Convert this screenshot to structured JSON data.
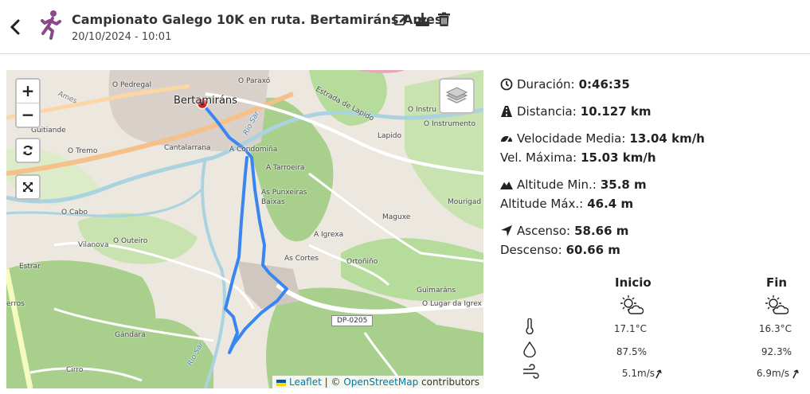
{
  "header": {
    "title": "Campionato Galego 10K en ruta. Bertamiráns Ames",
    "datetime": "20/10/2024 - 10:01"
  },
  "map": {
    "labels": [
      "O Pedregal",
      "O Paraxó",
      "Bertamiráns",
      "Estrada de Lapido",
      "O Instru",
      "O Instrumento",
      "Lapido",
      "Guitiande",
      "Ames",
      "Rio Sar",
      "O Tremo",
      "Cantalarrana",
      "A Condomiña",
      "A Tarroeira",
      "As Punxeiras Baixas",
      "Mourigad",
      "O Cabo",
      "Maguxe",
      "O Outeiro",
      "A Igrexa",
      "Vilanova",
      "As Cortes",
      "Ortoñiño",
      "Estrar",
      "Guimaráns",
      "O Lugar da Igrex",
      "erros",
      "Gándara",
      "Rio Sar",
      "Cirro"
    ],
    "road_ref": "DP-0205",
    "zoom_in": "+",
    "zoom_out": "−",
    "attribution": {
      "leaflet": "Leaflet",
      "sep": "| ©",
      "osm": "OpenStreetMap",
      "contributors": "contributors"
    }
  },
  "stats": {
    "duration_label": "Duración:",
    "duration_value": "0:46:35",
    "distance_label": "Distancia:",
    "distance_value": "10.127 km",
    "avg_speed_label": "Velocidade Media:",
    "avg_speed_value": "13.04 km/h",
    "max_speed_label": "Vel. Máxima:",
    "max_speed_value": "15.03 km/h",
    "min_alt_label": "Altitude Min.:",
    "min_alt_value": "35.8 m",
    "max_alt_label": "Altitude Máx.:",
    "max_alt_value": "46.4 m",
    "ascent_label": "Ascenso:",
    "ascent_value": "58.66 m",
    "descent_label": "Descenso:",
    "descent_value": "60.66 m"
  },
  "weather": {
    "start_label": "Inicio",
    "end_label": "Fin",
    "start": {
      "temperature": "17.1°C",
      "humidity": "87.5%",
      "wind": "5.1m/s"
    },
    "end": {
      "temperature": "16.3°C",
      "humidity": "92.3%",
      "wind": "6.9m/s"
    }
  },
  "colors": {
    "route": "#3a86f0",
    "marker": "#d62020",
    "accent": "#0078a8"
  }
}
